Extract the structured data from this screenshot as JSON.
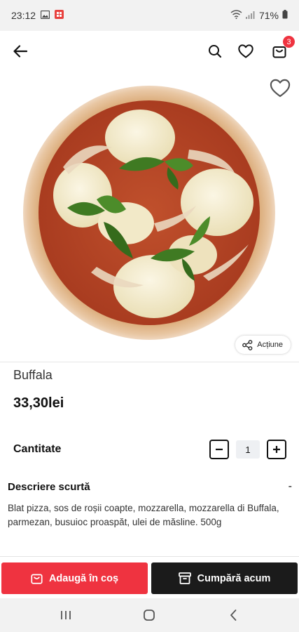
{
  "status_bar": {
    "time": "23:12",
    "battery": "71%"
  },
  "app_bar": {
    "cart_count": "3"
  },
  "product": {
    "name": "Buffala",
    "price": "33,30lei",
    "share_label": "Acțiune",
    "image_alt": "pizza"
  },
  "quantity": {
    "label": "Cantitate",
    "value": "1"
  },
  "description": {
    "title": "Descriere scurtă",
    "toggle": "-",
    "text": "Blat pizza, sos de roșii coapte, mozzarella, mozzarella di Buffala, parmezan, busuioc proaspăt, ulei de măsline. 500g"
  },
  "actions": {
    "add_to_cart": "Adaugă în coș",
    "buy_now": "Cumpără acum"
  },
  "colors": {
    "accent_red": "#ef3340",
    "dark_button": "#1b1b1b"
  },
  "icons": {
    "back": "arrow-left-icon",
    "search": "search-icon",
    "favorite": "heart-icon",
    "cart": "shopping-bag-icon",
    "share": "share-icon",
    "minus": "minus-icon",
    "plus": "plus-icon",
    "archive": "archive-box-icon"
  }
}
